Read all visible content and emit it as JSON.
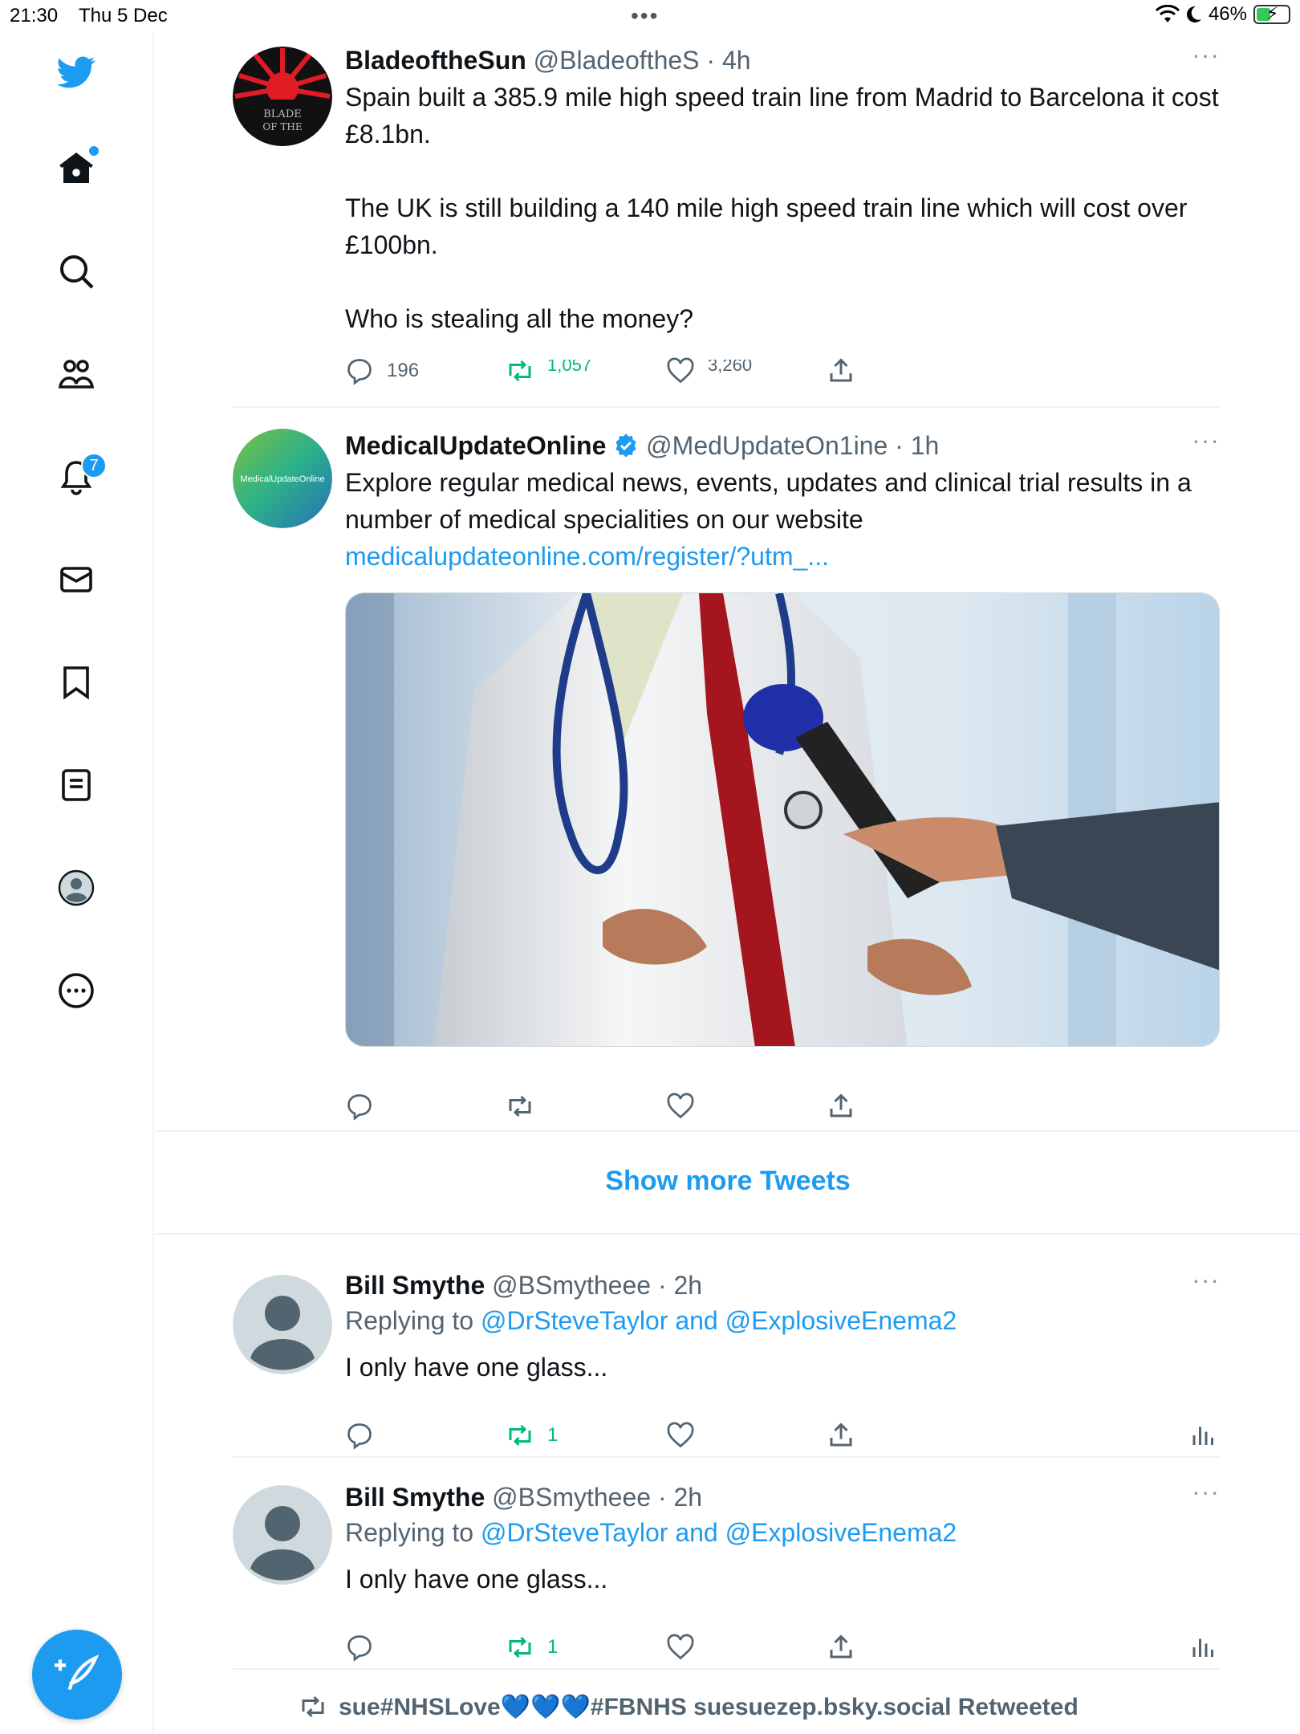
{
  "status": {
    "time": "21:30",
    "date": "Thu 5 Dec",
    "battery": "46%",
    "battery_level": 0.46
  },
  "sidebar": {
    "items": [
      {
        "name": "twitter-logo-icon"
      },
      {
        "name": "home-icon"
      },
      {
        "name": "search-icon"
      },
      {
        "name": "communities-icon"
      },
      {
        "name": "notifications-icon",
        "badge": "7"
      },
      {
        "name": "messages-icon"
      },
      {
        "name": "bookmarks-icon"
      },
      {
        "name": "lists-icon"
      },
      {
        "name": "profile-icon"
      },
      {
        "name": "more-icon"
      }
    ],
    "compose": "compose-icon"
  },
  "feed": {
    "tweets": [
      {
        "name": "BladeoftheSun",
        "handle": "@BladeoftheS",
        "time": "· 4h",
        "text": "Spain built a 385.9 mile high speed train line from Madrid to Barcelona it cost £8.1bn.\n\nThe UK is still building a 140 mile high speed train line which will cost over £100bn.\n\nWho is stealing all the money?",
        "avatar_text": "BLADE OF THE SUN",
        "replies": "196",
        "retweets": "1,057",
        "likes": "3,260"
      },
      {
        "name": "MedicalUpdateOnline",
        "handle": "@MedUpdateOn1ine",
        "time": "· 1h",
        "verified": true,
        "text": "Explore regular medical news, events, updates and clinical trial results in a number of medical specialities on our website",
        "link": "medicalupdateonline.com/register/?utm_...",
        "avatar_text": "MedicalUpdateOnline"
      }
    ],
    "show_more": "Show more Tweets",
    "replies": [
      {
        "name": "Bill Smythe",
        "handle": "@BSmytheee",
        "time": "· 2h",
        "replying_prefix": "Replying to",
        "replying_to": "@DrSteveTaylor and @ExplosiveEnema2",
        "text": "I only have one glass...",
        "retweets": "1"
      },
      {
        "name": "Bill Smythe",
        "handle": "@BSmytheee",
        "time": "· 2h",
        "replying_prefix": "Replying to",
        "replying_to": "@DrSteveTaylor and @ExplosiveEnema2",
        "text": "I only have one glass...",
        "retweets": "1"
      }
    ],
    "retweeted_by": "sue#NHSLove💙💙💙#FBNHS suesuezep.bsky.social Retweeted"
  },
  "colors": {
    "accent": "#1d9bf0",
    "retweet": "#00ba7c",
    "muted": "#536471"
  }
}
